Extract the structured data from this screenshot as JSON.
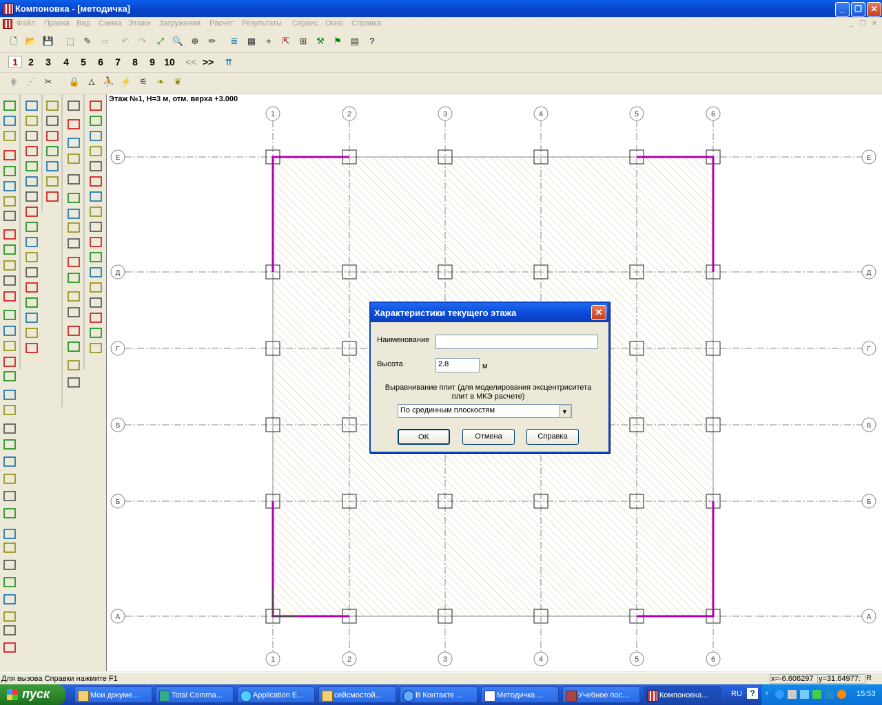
{
  "window": {
    "title": "Компоновка - [методичка]"
  },
  "menu": [
    "Файл",
    "Правка",
    "Вид",
    "Схема",
    "Этажи",
    "Загружения",
    "Расчет",
    "Результаты",
    "Сервис",
    "Окно",
    "Справка"
  ],
  "floor_tabs": [
    "1",
    "2",
    "3",
    "4",
    "5",
    "6",
    "7",
    "8",
    "9",
    "10",
    "<<",
    ">>"
  ],
  "canvas": {
    "floor_label": "Этаж №1, H=3 м, отм. верха +3.000",
    "axes_x": [
      "1",
      "2",
      "3",
      "4",
      "5",
      "6"
    ],
    "axes_y": [
      "Е",
      "Д",
      "Г",
      "В",
      "Б",
      "А"
    ]
  },
  "dialog": {
    "title": "Характеристики текущего этажа",
    "name_label": "Наименование",
    "name_value": "",
    "height_label": "Высота",
    "height_value": "2.8",
    "height_unit": "м",
    "align_label_1": "Выравнивание плит (для моделирования эксцентриситета",
    "align_label_2": "плит в МКЭ расчете)",
    "align_value": "По срединным плоскостям",
    "ok": "OK",
    "cancel": "Отмена",
    "help": "Справка"
  },
  "status": {
    "hint": "Для вызова Справки нажмите F1",
    "x": "x=-6.606297",
    "y": "y=31.64977:",
    "mode": "R"
  },
  "taskbar": {
    "start": "пуск",
    "tasks": [
      "Мои докуме...",
      "Total Comma...",
      "Application E...",
      "сейсмостой...",
      "В Контакте ...",
      "Методичка ...",
      "Учебное пос...",
      "Компоновка..."
    ],
    "lang": "RU",
    "time": "15:53"
  },
  "colors": {
    "wall": "#b000b0",
    "hatch": "#c8c890",
    "titlebar": "#0a47d6"
  }
}
